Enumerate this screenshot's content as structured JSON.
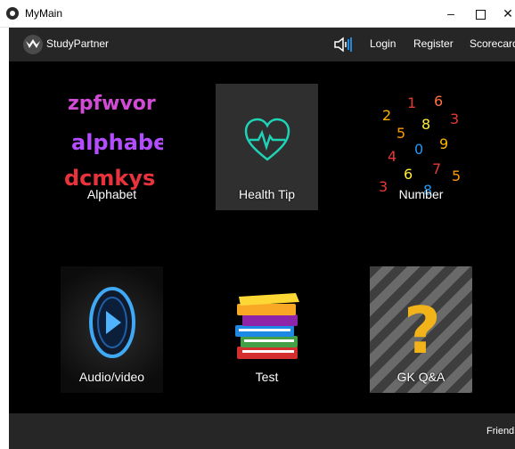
{
  "window": {
    "title": "MyMain",
    "minimize_glyph": "–",
    "close_glyph": "✕"
  },
  "appbar": {
    "brand": "StudyPartner",
    "nav": {
      "login": "Login",
      "register": "Register",
      "scorecard": "Scorecard"
    }
  },
  "tiles": [
    {
      "label": "Alphabet"
    },
    {
      "label": "Health Tip"
    },
    {
      "label": "Number"
    },
    {
      "label": "Audio/video"
    },
    {
      "label": "Test"
    },
    {
      "label": "GK Q&A"
    }
  ],
  "footer": {
    "friend": "Friend"
  },
  "art": {
    "alphabet_rows": [
      "zpfwvor",
      "alphabet",
      "dcmkys"
    ],
    "number_glyphs": [
      "2",
      "1",
      "6",
      "8",
      "3",
      "5",
      "0",
      "9",
      "4",
      "7",
      "6",
      "5",
      "3",
      "8"
    ],
    "gk_glyph": "?"
  },
  "colors": {
    "appbar": "#262626",
    "content": "#000000",
    "text": "#ffffff"
  }
}
